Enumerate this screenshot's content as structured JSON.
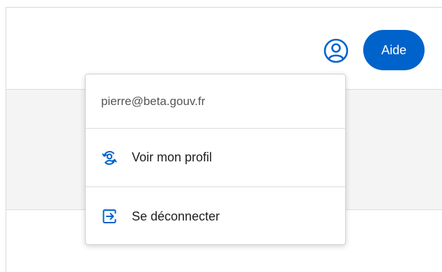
{
  "header": {
    "user_icon": "user-circle-icon",
    "help_label": "Aide",
    "accent_color": "#0063cb"
  },
  "user_menu": {
    "email": "pierre@beta.gouv.fr",
    "items": [
      {
        "label": "Voir mon profil",
        "icon": "profile-sync-icon"
      },
      {
        "label": "Se déconnecter",
        "icon": "logout-icon"
      }
    ]
  }
}
